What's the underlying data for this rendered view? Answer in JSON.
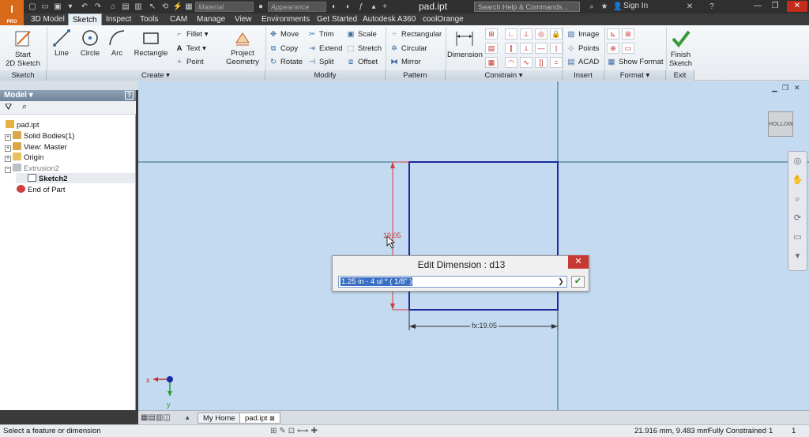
{
  "app": {
    "logo_text": "I",
    "logo_sub": "PRO"
  },
  "titlebar": {
    "material_placeholder": "Material",
    "appearance_placeholder": "Appearance",
    "document_title": "pad.ipt",
    "search_placeholder": "Search Help & Commands...",
    "sign_in": "Sign In"
  },
  "tabs": [
    {
      "label": "3D Model"
    },
    {
      "label": "Sketch"
    },
    {
      "label": "Inspect"
    },
    {
      "label": "Tools"
    },
    {
      "label": "CAM"
    },
    {
      "label": "Manage"
    },
    {
      "label": "View"
    },
    {
      "label": "Environments"
    },
    {
      "label": "Get Started"
    },
    {
      "label": "Autodesk A360"
    },
    {
      "label": "coolOrange"
    }
  ],
  "ribbon": {
    "sketch": {
      "start_label_1": "Start",
      "start_label_2": "2D Sketch",
      "panel": "Sketch"
    },
    "create": {
      "line": "Line",
      "circle": "Circle",
      "arc": "Arc",
      "rectangle": "Rectangle",
      "fillet": "Fillet",
      "text": "Text",
      "point": "Point",
      "project_1": "Project",
      "project_2": "Geometry",
      "panel": "Create"
    },
    "modify": {
      "move": "Move",
      "copy": "Copy",
      "rotate": "Rotate",
      "trim": "Trim",
      "extend": "Extend",
      "split": "Split",
      "scale": "Scale",
      "stretch": "Stretch",
      "offset": "Offset",
      "panel": "Modify"
    },
    "pattern": {
      "rectangular": "Rectangular",
      "circular": "Circular",
      "mirror": "Mirror",
      "panel": "Pattern"
    },
    "constrain": {
      "dimension": "Dimension",
      "panel": "Constrain"
    },
    "insert": {
      "image": "Image",
      "points": "Points",
      "acad": "ACAD",
      "panel": "Insert"
    },
    "format": {
      "show_format": "Show Format",
      "panel": "Format"
    },
    "exit": {
      "finish_1": "Finish",
      "finish_2": "Sketch",
      "panel": "Exit"
    }
  },
  "browser": {
    "title": "Model",
    "help": "?",
    "items": [
      {
        "label": "pad.ipt"
      },
      {
        "label": "Solid Bodies(1)"
      },
      {
        "label": "View: Master"
      },
      {
        "label": "Origin"
      },
      {
        "label": "Extrusion2"
      },
      {
        "label": "Sketch2"
      },
      {
        "label": "End of Part"
      }
    ]
  },
  "canvas": {
    "dimension_vertical": "19.05",
    "dimension_horizontal": "fx:19.05",
    "viewcube_face": "HOLLOW"
  },
  "dialog": {
    "title": "Edit Dimension : d13",
    "value": "1.25 in - 4 ul * ( 1/8\" )",
    "close": "✕",
    "ok": "✔"
  },
  "doc_tabs": [
    {
      "label": "My Home"
    },
    {
      "label": "pad.ipt"
    }
  ],
  "status": {
    "message": "Select a feature or dimension",
    "coordinates": "21.916 mm, 9.483 mm",
    "constraint_state": "Fully Constrained",
    "count_1": "1",
    "count_2": "1"
  },
  "colors": {
    "accent_orange": "#d86a1a",
    "canvas_bg": "#c3daf0",
    "sketch_line": "#1a2a9a",
    "dimension_red": "#d04040",
    "axis_teal": "#2a6a7a"
  }
}
